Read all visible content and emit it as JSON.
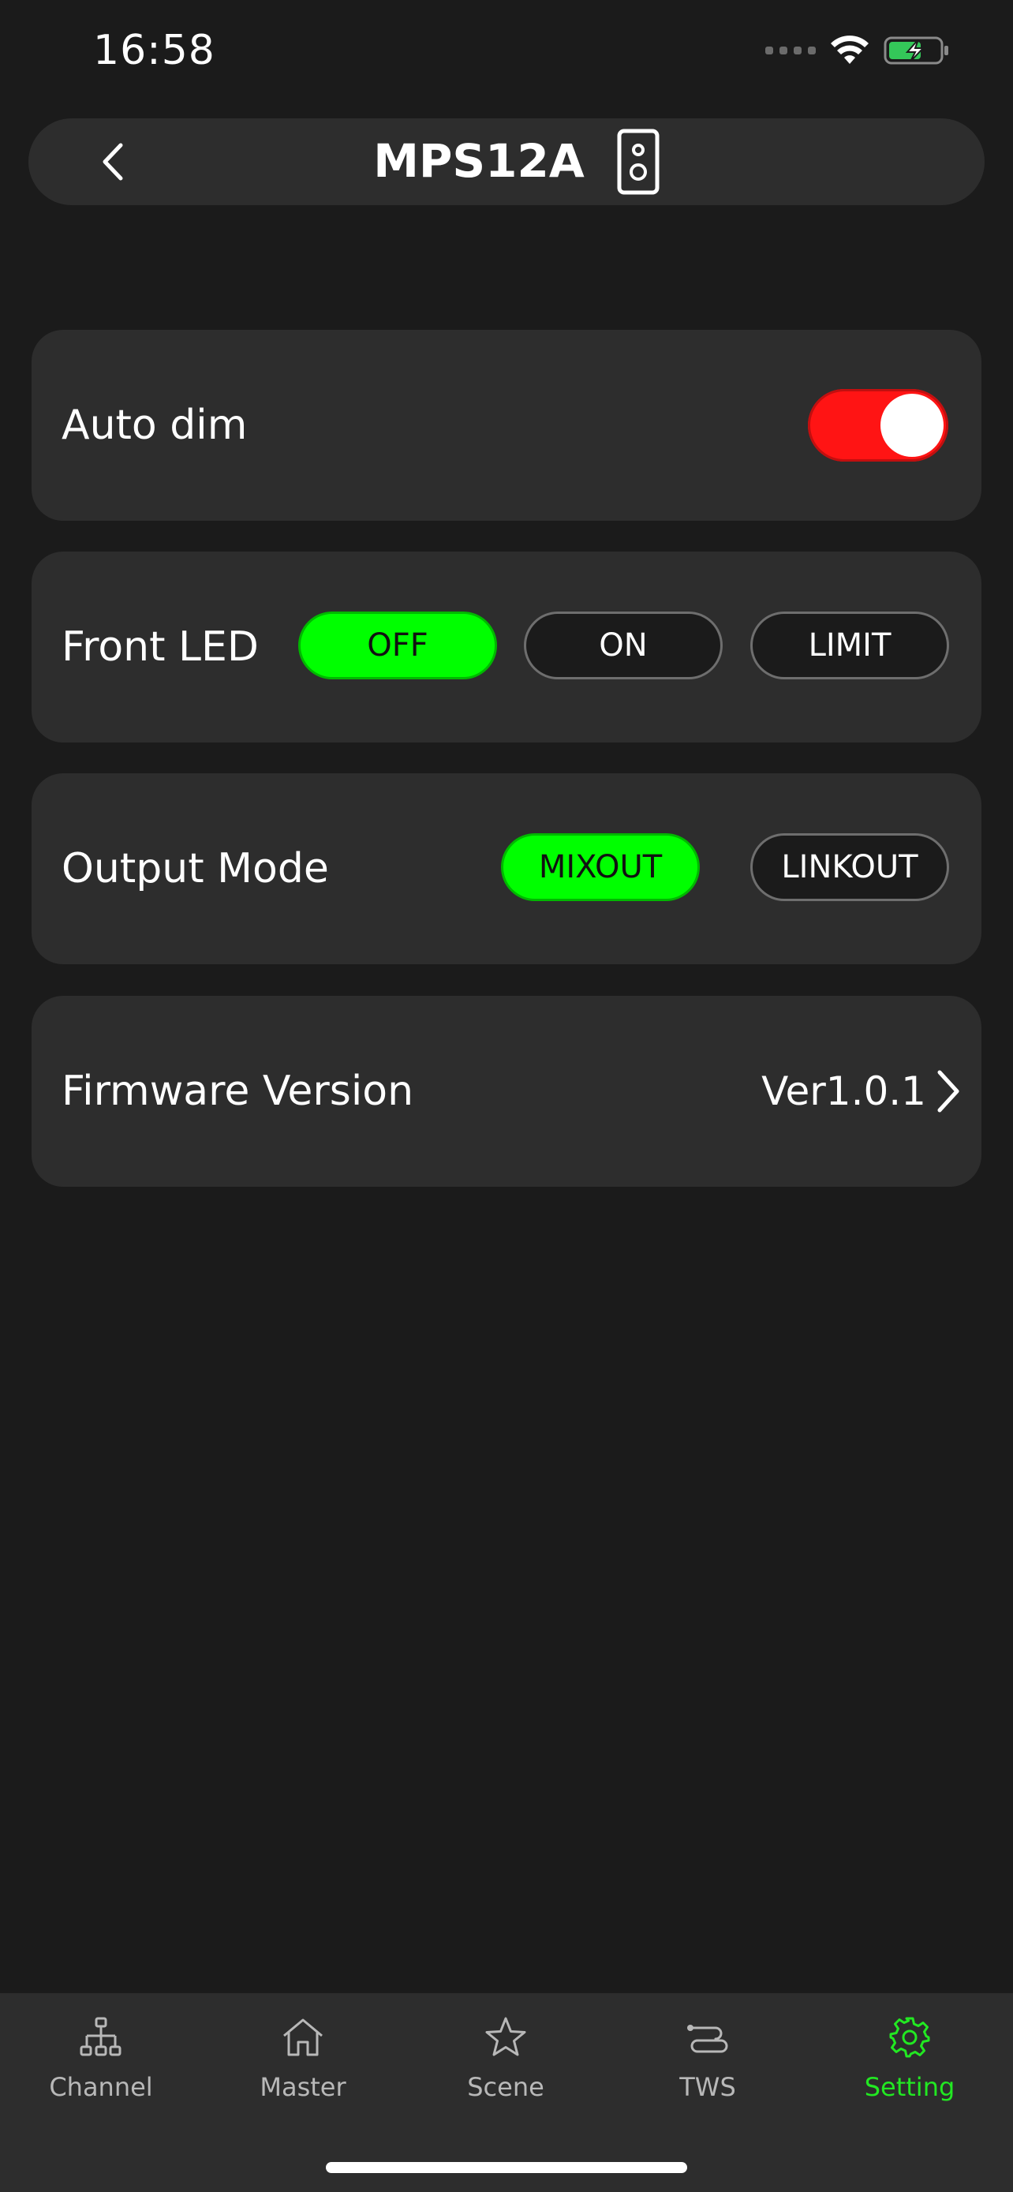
{
  "status_bar": {
    "time": "16:58"
  },
  "header": {
    "title": "MPS12A"
  },
  "auto_dim": {
    "label": "Auto dim",
    "enabled": true
  },
  "front_led": {
    "label": "Front LED",
    "options": [
      "OFF",
      "ON",
      "LIMIT"
    ],
    "selected": "OFF"
  },
  "output_mode": {
    "label": "Output Mode",
    "options": [
      "MIXOUT",
      "LINKOUT"
    ],
    "selected": "MIXOUT"
  },
  "firmware": {
    "label": "Firmware Version",
    "value": "Ver1.0.1"
  },
  "tabbar": {
    "items": [
      {
        "label": "Channel",
        "icon": "network-tree-icon"
      },
      {
        "label": "Master",
        "icon": "home-icon"
      },
      {
        "label": "Scene",
        "icon": "star-icon"
      },
      {
        "label": "TWS",
        "icon": "link-toggle-icon"
      },
      {
        "label": "Setting",
        "icon": "gear-icon"
      }
    ],
    "active": "Setting"
  },
  "colors": {
    "background": "#1b1b1b",
    "card": "#2d2d2d",
    "active_green": "#00ff00",
    "toggle_red": "#ff1414",
    "tab_active": "#22e822"
  }
}
